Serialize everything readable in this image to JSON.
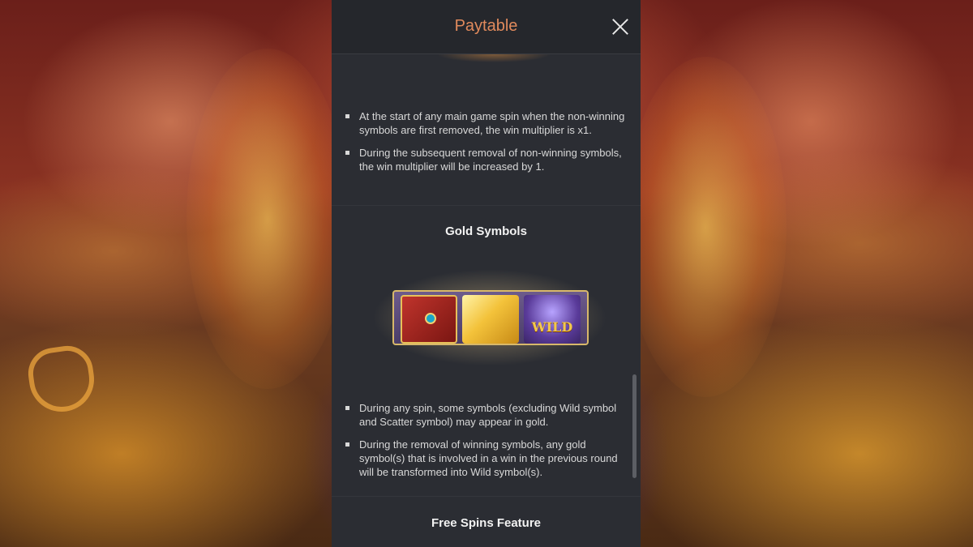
{
  "panel": {
    "title": "Paytable"
  },
  "multiplier_section": {
    "bullets": [
      "At the start of any main game spin when the non-winning symbols are first removed, the win multiplier is x1.",
      "During the subsequent removal of non-winning symbols, the win multiplier will be increased by 1."
    ]
  },
  "gold_symbols_section": {
    "title": "Gold Symbols",
    "image_wild_label": "WILD",
    "bullets": [
      "During any spin, some symbols (excluding Wild symbol and Scatter symbol) may appear in gold.",
      "During the removal of winning symbols, any gold symbol(s) that is involved in a win in the previous round will be transformed into Wild symbol(s)."
    ]
  },
  "free_spins_section": {
    "title": "Free Spins Feature"
  },
  "colors": {
    "title_accent": "#e08a5c",
    "panel_bg": "#2b2d33",
    "header_bg": "#25272c"
  },
  "icons": [
    "close-icon"
  ]
}
